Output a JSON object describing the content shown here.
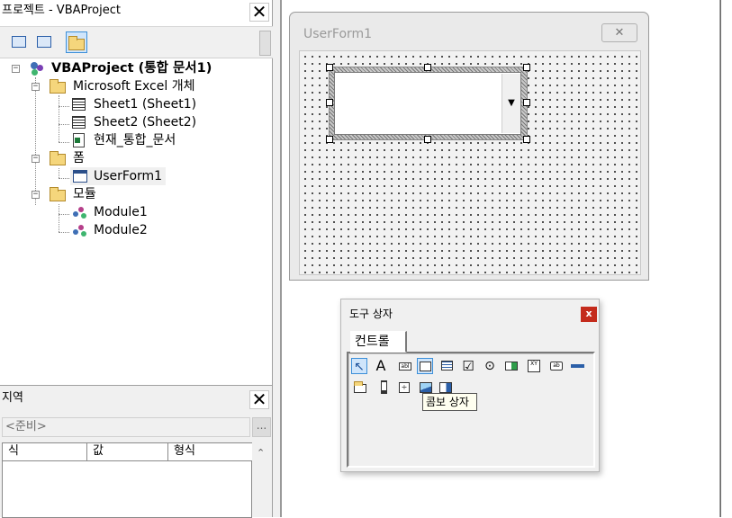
{
  "project_pane": {
    "title": "프로젝트 - VBAProject",
    "close_glyph": "✕",
    "toolbar": [
      {
        "icon": "view-code-icon"
      },
      {
        "icon": "view-object-icon"
      },
      {
        "icon": "toggle-folders-icon",
        "active": true
      }
    ],
    "tree": {
      "root": "VBAProject (통합 문서1)",
      "excel_objects": {
        "label": "Microsoft Excel 개체",
        "items": [
          "Sheet1 (Sheet1)",
          "Sheet2 (Sheet2)",
          "현재_통합_문서"
        ]
      },
      "forms": {
        "label": "폼",
        "items": [
          "UserForm1"
        ]
      },
      "modules": {
        "label": "모듈",
        "items": [
          "Module1",
          "Module2"
        ]
      }
    }
  },
  "locals_pane": {
    "title": "지역",
    "close_glyph": "✕",
    "context": "<준비>",
    "context_button": "...",
    "columns": [
      "식",
      "값",
      "형식"
    ],
    "scroll_up_glyph": "⌃"
  },
  "designer": {
    "form_caption": "UserForm1",
    "form_close_glyph": "✕",
    "combo_arrow": "▼"
  },
  "toolbox": {
    "title": "도구 상자",
    "close_glyph": "x",
    "tab": "컨트롤",
    "row1": [
      {
        "name": "select-objects-tool",
        "glyph": "↖"
      },
      {
        "name": "label-tool",
        "glyph": "A"
      },
      {
        "name": "textbox-tool",
        "glyph": "abl"
      },
      {
        "name": "combobox-tool",
        "glyph": "",
        "selected": true
      },
      {
        "name": "listbox-tool",
        "glyph": ""
      },
      {
        "name": "checkbox-tool",
        "glyph": "☑"
      },
      {
        "name": "optionbutton-tool",
        "glyph": "⊙"
      },
      {
        "name": "togglebutton-tool",
        "glyph": ""
      },
      {
        "name": "frame-tool",
        "glyph": "XY"
      },
      {
        "name": "commandbutton-tool",
        "glyph": "ab"
      },
      {
        "name": "tabstrip-tool",
        "glyph": ""
      }
    ],
    "row2": [
      {
        "name": "multipage-tool"
      },
      {
        "name": "scrollbar-tool"
      },
      {
        "name": "spinbutton-tool"
      },
      {
        "name": "image-tool"
      },
      {
        "name": "refedit-tool"
      }
    ],
    "tooltip": "콤보 상자"
  }
}
